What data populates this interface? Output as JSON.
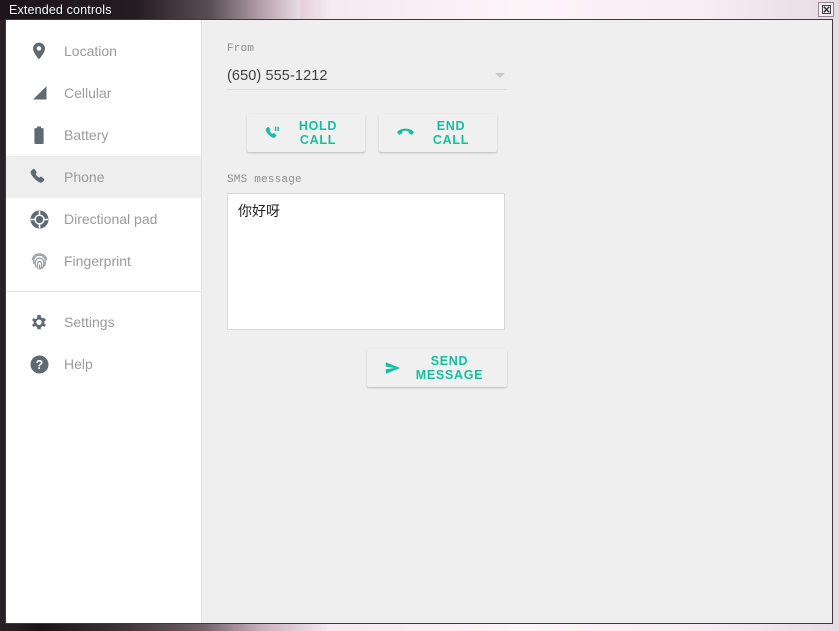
{
  "window": {
    "title": "Extended controls",
    "close_button_icon": "close-window-icon"
  },
  "sidebar": {
    "items": [
      {
        "id": "location",
        "label": "Location",
        "icon": "location-pin-icon",
        "selected": false
      },
      {
        "id": "cellular",
        "label": "Cellular",
        "icon": "cellular-signal-icon",
        "selected": false
      },
      {
        "id": "battery",
        "label": "Battery",
        "icon": "battery-icon",
        "selected": false
      },
      {
        "id": "phone",
        "label": "Phone",
        "icon": "phone-icon",
        "selected": true
      },
      {
        "id": "directional-pad",
        "label": "Directional pad",
        "icon": "dpad-icon",
        "selected": false
      },
      {
        "id": "fingerprint",
        "label": "Fingerprint",
        "icon": "fingerprint-icon",
        "selected": false
      },
      {
        "id": "settings",
        "label": "Settings",
        "icon": "gear-icon",
        "selected": false
      },
      {
        "id": "help",
        "label": "Help",
        "icon": "help-circle-icon",
        "selected": false
      }
    ]
  },
  "main": {
    "from": {
      "label": "From",
      "value": "(650) 555-1212",
      "caret_icon": "chevron-down-icon"
    },
    "hold_call": {
      "label": "HOLD CALL",
      "icon": "phone-pause-icon"
    },
    "end_call": {
      "label": "END CALL",
      "icon": "phone-hangup-icon"
    },
    "sms": {
      "label": "SMS message",
      "value": "你好呀",
      "placeholder": ""
    },
    "send_message": {
      "label": "SEND MESSAGE",
      "icon": "send-plane-icon"
    }
  },
  "colors": {
    "accent_teal": "#14bfa1",
    "sidebar_bg": "#ffffff",
    "main_bg": "#efefef",
    "selected_row": "#eeeeee",
    "label_gray": "#8d8d8d",
    "icon_gray": "#5d6a72"
  }
}
